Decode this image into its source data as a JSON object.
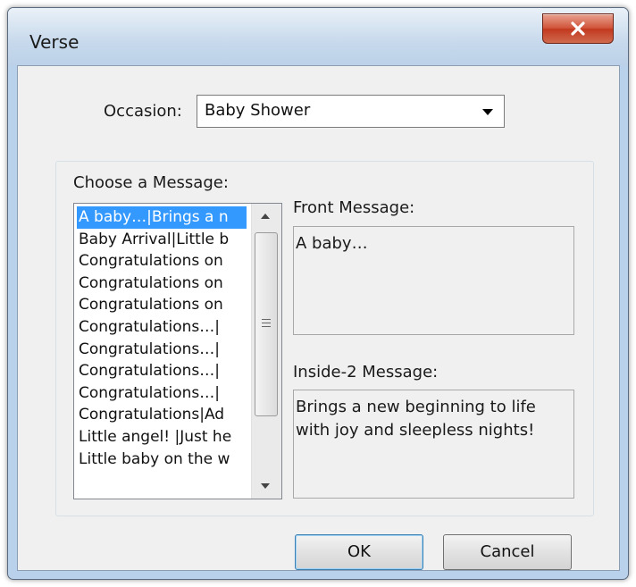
{
  "window": {
    "title": "Verse"
  },
  "occasion": {
    "label": "Occasion:",
    "selected": "Baby Shower"
  },
  "messages": {
    "label": "Choose a Message:",
    "items": [
      "A baby…|Brings a n",
      "Baby Arrival|Little b",
      "Congratulations on",
      "Congratulations on",
      "Congratulations on",
      "Congratulations…|",
      "Congratulations…|",
      "Congratulations…|",
      "Congratulations…|",
      "Congratulations|Ad",
      "Little angel! |Just he",
      "Little baby on the w"
    ],
    "selected_index": 0
  },
  "front": {
    "label": "Front Message:",
    "text": "A baby…"
  },
  "inside": {
    "label": "Inside-2 Message:",
    "text": "Brings a new beginning to life\nwith joy and sleepless nights!"
  },
  "buttons": {
    "ok": "OK",
    "cancel": "Cancel"
  },
  "icons": {
    "close": "close-icon",
    "dropdown": "chevron-down-icon",
    "scroll_up": "scroll-up-icon",
    "scroll_down": "scroll-down-icon"
  }
}
